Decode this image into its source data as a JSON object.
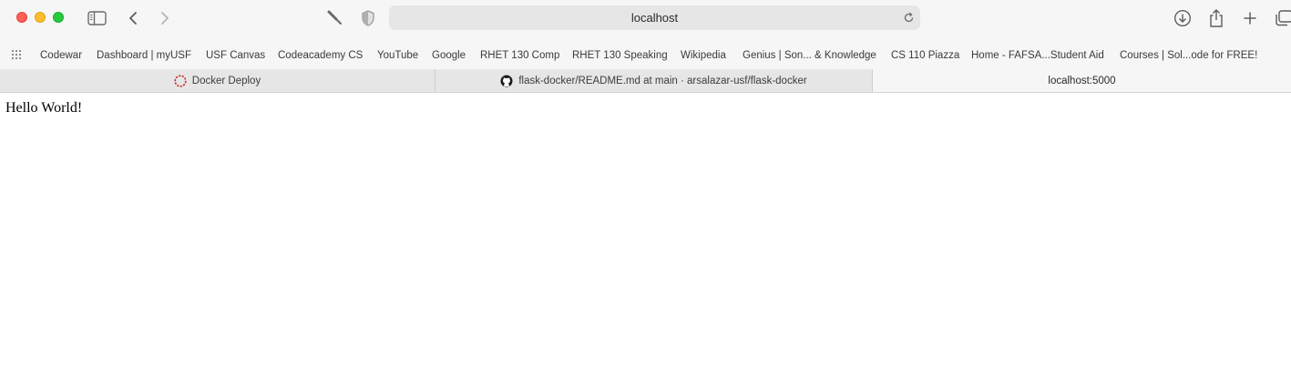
{
  "window": {
    "traffic_lights": [
      "close",
      "minimize",
      "zoom"
    ],
    "colors": {
      "close": "#ff5f57",
      "minimize": "#febc2e",
      "zoom": "#28c840"
    }
  },
  "toolbar": {
    "icons": [
      "sidebar-icon",
      "back-icon",
      "forward-icon",
      "paintbrush-icon",
      "privacy-shield-icon",
      "download-icon",
      "share-icon",
      "new-tab-icon",
      "tab-overview-icon"
    ],
    "url": "localhost"
  },
  "bookmarks": {
    "items": [
      "Codewar",
      "Dashboard | myUSF",
      "USF Canvas",
      "Codeacademy CS",
      "YouTube",
      "Google",
      "RHET 130 Comp",
      "RHET 130 Speaking",
      "Wikipedia",
      "Genius | Son... & Knowledge",
      "CS 110 Piazza",
      "Home - FAFSA...Student Aid",
      "Courses | Sol...ode for FREE!"
    ]
  },
  "tabs": [
    {
      "label": "Docker Deploy",
      "icon": "docker-deploy-favicon",
      "active": false
    },
    {
      "label": "flask-docker/README.md at main · arsalazar-usf/flask-docker",
      "icon": "github-icon",
      "active": false
    },
    {
      "label": "localhost:5000",
      "icon": "",
      "active": true
    }
  ],
  "page": {
    "body_text": "Hello World!"
  }
}
